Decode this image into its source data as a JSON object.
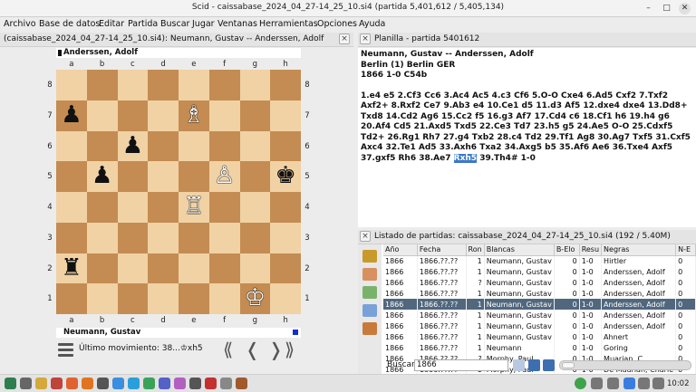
{
  "window": {
    "title": "Scid - caissabase_2024_04_27-14_25_10.si4 (partida 5,401,612 / 5,405,134)"
  },
  "menubar": [
    "Archivo",
    "Base de datos",
    "Editar",
    "Partida",
    "Buscar",
    "Jugar",
    "Ventanas",
    "Herramientas",
    "Opciones",
    "Ayuda"
  ],
  "board_tab": {
    "label": "(caissabase_2024_04_27-14_25_10.si4): Neumann, Gustav -- Anderssen, Adolf"
  },
  "board": {
    "top_player": "Anderssen, Adolf",
    "bottom_player": "Neumann, Gustav",
    "files": [
      "a",
      "b",
      "c",
      "d",
      "e",
      "f",
      "g",
      "h"
    ],
    "ranks": [
      "8",
      "7",
      "6",
      "5",
      "4",
      "3",
      "2",
      "1"
    ],
    "pieces": [
      {
        "square": "a7",
        "glyph": "♟",
        "color": "b"
      },
      {
        "square": "e7",
        "glyph": "♗",
        "color": "w"
      },
      {
        "square": "c6",
        "glyph": "♟",
        "color": "b"
      },
      {
        "square": "b5",
        "glyph": "♟",
        "color": "b"
      },
      {
        "square": "f5",
        "glyph": "♙",
        "color": "w"
      },
      {
        "square": "h5",
        "glyph": "♚",
        "color": "b"
      },
      {
        "square": "e4",
        "glyph": "♖",
        "color": "w"
      },
      {
        "square": "a2",
        "glyph": "♜",
        "color": "b"
      },
      {
        "square": "g1",
        "glyph": "♔",
        "color": "w"
      }
    ],
    "last_move": "Último movimiento: 38...♔xh5"
  },
  "nav": {
    "first": "⟪",
    "prev": "❬",
    "next": "❭",
    "last": "⟫"
  },
  "planilla": {
    "tab_label": "Planilla - partida 5401612",
    "header_line1": "Neumann, Gustav   --   Anderssen, Adolf",
    "header_line2": "Berlin (1)  Berlin GER",
    "header_line3": "1866  1-0  C54b",
    "moves_before": "1.e4 e5 2.Cf3 Cc6 3.Ac4 Ac5 4.c3 Cf6 5.O-O Cxe4 6.Ad5 Cxf2 7.Txf2 Axf2+ 8.Rxf2 Ce7 9.Ab3 e4 10.Ce1 d5 11.d3 Af5 12.dxe4 dxe4 13.Dd8+ Txd8 14.Cd2 Ag6 15.Cc2 f5 16.g3 Af7 17.Cd4 c6 18.Cf1 h6 19.h4 g6 20.Af4 Cd5 21.Axd5 Txd5 22.Ce3 Td7 23.h5 g5 24.Ae5 O-O 25.Cdxf5 Td2+ 26.Rg1 Rh7 27.g4 Txb2 28.c4 Td2 29.Tf1 Ag8 30.Ag7 Txf5 31.Cxf5 Axc4 32.Te1 Ad5 33.Axh6 Txa2 34.Axg5 b5 35.Af6 Ae6 36.Txe4 Axf5 37.gxf5 Rh6 38.Ae7 ",
    "moves_current": "Rxh5",
    "moves_after": " 39.Th4# 1-0"
  },
  "game_list": {
    "tab_label": "Listado de partidas: caissabase_2024_04_27-14_25_10.si4 (192 / 5.40M)",
    "columns": [
      "Año",
      "Fecha",
      "Ron",
      "Blancas",
      "B-Elo",
      "Resu",
      "Negras",
      "N-E"
    ],
    "rows": [
      [
        "1866",
        "1866.??.??",
        "1",
        "Neumann, Gustav",
        "0",
        "1-0",
        "Hirtler",
        "0"
      ],
      [
        "1866",
        "1866.??.??",
        "1",
        "Neumann, Gustav",
        "0",
        "1-0",
        "Anderssen, Adolf",
        "0"
      ],
      [
        "1866",
        "1866.??.??",
        "?",
        "Neumann, Gustav",
        "0",
        "1-0",
        "Anderssen, Adolf",
        "0"
      ],
      [
        "1866",
        "1866.??.??",
        "1",
        "Neumann, Gustav",
        "0",
        "1-0",
        "Anderssen, Adolf",
        "0"
      ],
      [
        "1866",
        "1866.??.??",
        "1",
        "Neumann, Gustav",
        "0",
        "1-0",
        "Anderssen, Adolf",
        "0"
      ],
      [
        "1866",
        "1866.??.??",
        "1",
        "Neumann, Gustav",
        "0",
        "1-0",
        "Anderssen, Adolf",
        "0"
      ],
      [
        "1866",
        "1866.??.??",
        "1",
        "Neumann, Gustav",
        "0",
        "1-0",
        "Anderssen, Adolf",
        "0"
      ],
      [
        "1866",
        "1866.??.??",
        "1",
        "Neumann, Gustav",
        "0",
        "1-0",
        "Ahnert",
        "0"
      ],
      [
        "1866",
        "1866.??.??",
        "1",
        "Neumann",
        "0",
        "1-0",
        "Goring",
        "0"
      ],
      [
        "1866",
        "1866.??.??",
        "?",
        "Morphy, Paul",
        "0",
        "1-0",
        "Muarian, C.",
        "0"
      ],
      [
        "1866",
        "1866.??.??",
        "1",
        "Morphy, Paul",
        "0",
        "1-0",
        "De Maurian, Charle",
        "0"
      ]
    ],
    "selected_row": 4
  },
  "search": {
    "label": "Buscar",
    "value": "1866"
  },
  "taskbar": {
    "clock": "10:02"
  }
}
